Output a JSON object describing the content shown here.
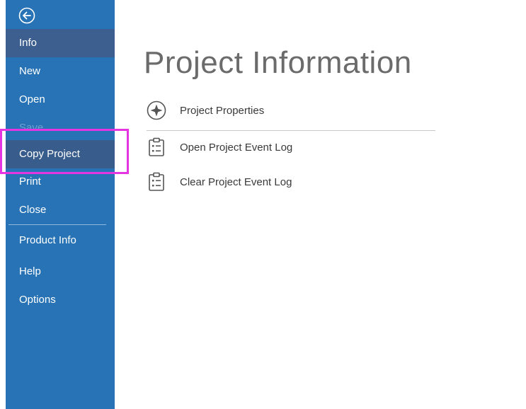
{
  "sidebar": {
    "back_icon": "arrow-left-circle-icon",
    "items": [
      {
        "label": "Info",
        "state": "active"
      },
      {
        "label": "New",
        "state": "normal"
      },
      {
        "label": "Open",
        "state": "normal"
      },
      {
        "label": "Save",
        "state": "disabled"
      },
      {
        "label": "Copy Project",
        "state": "selected"
      },
      {
        "label": "Print",
        "state": "normal"
      },
      {
        "label": "Close",
        "state": "normal"
      },
      {
        "label": "Product Info",
        "state": "normal"
      },
      {
        "label": "Help",
        "state": "normal"
      },
      {
        "label": "Options",
        "state": "normal"
      }
    ]
  },
  "main": {
    "title": "Project Information",
    "actions": [
      {
        "label": "Project Properties",
        "icon": "compass-star-icon"
      },
      {
        "label": "Open Project Event Log",
        "icon": "clipboard-list-icon"
      },
      {
        "label": "Clear Project Event Log",
        "icon": "clipboard-list-icon"
      }
    ]
  },
  "colors": {
    "sidebar_bg": "#2773b5",
    "sidebar_active": "#3d5f8f",
    "highlight": "#e535e3",
    "title": "#6b6b6b"
  }
}
